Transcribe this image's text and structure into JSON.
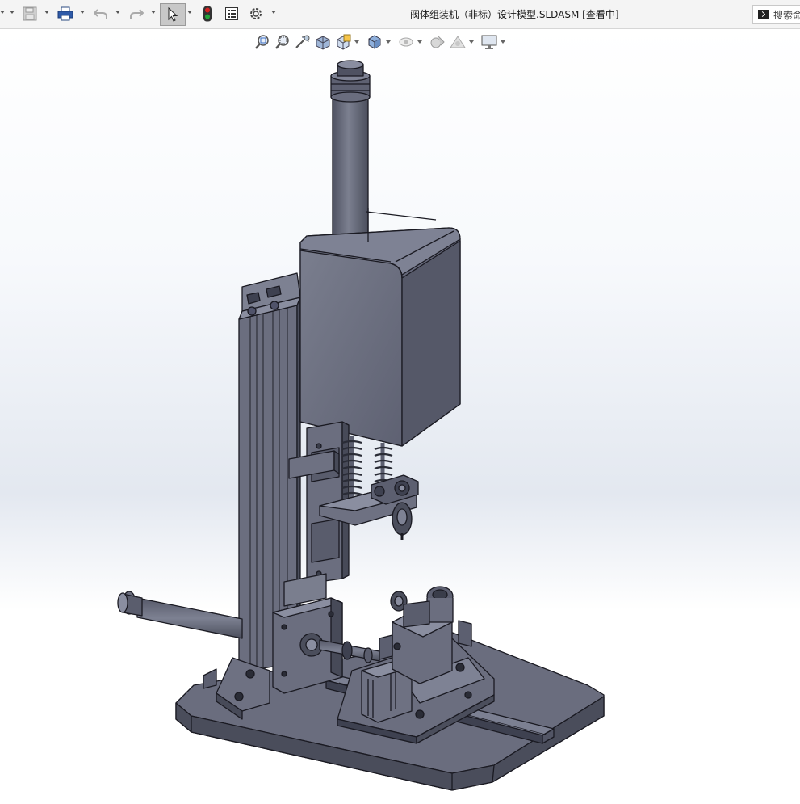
{
  "toolbar": {
    "title": "阀体组装机（非标）设计模型.SLDASM [查看中]",
    "search_label": "搜索命",
    "buttons": [
      "save-icon",
      "print-icon",
      "undo-icon",
      "redo-icon",
      "select-icon",
      "rebuild-traffic-light-icon",
      "file-properties-icon",
      "options-gear-icon"
    ]
  },
  "heads_up_toolbar": {
    "buttons": [
      "zoom-to-fit-icon",
      "zoom-to-area-icon",
      "previous-view-icon",
      "section-view-icon",
      "view-orientation-icon",
      "display-style-icon",
      "hide-show-items-icon",
      "edit-appearance-icon",
      "apply-scene-icon",
      "view-settings-icon"
    ]
  },
  "colors": {
    "part_fill": "#6c6f80",
    "part_dark": "#4b4e5c",
    "part_light": "#8c90a0",
    "edge": "#1a1a22",
    "toolbar_bg": "#f4f4f4",
    "select_active": "#c8c8c8",
    "traffic_red": "#d32222",
    "traffic_green": "#22a63a"
  }
}
